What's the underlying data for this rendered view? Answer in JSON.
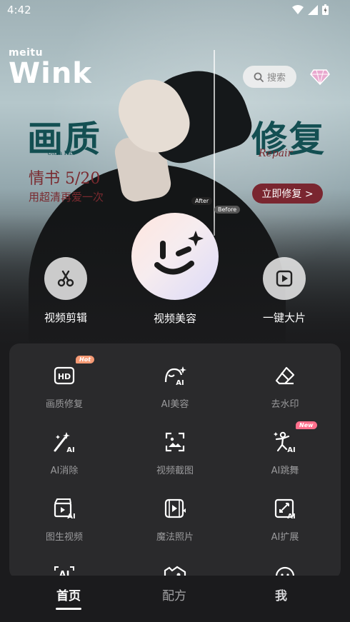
{
  "status_bar": {
    "time": "4:42"
  },
  "brand": {
    "top": "meitu",
    "name": "Wink"
  },
  "search": {
    "placeholder": "搜索"
  },
  "banner": {
    "title_left": "画质",
    "subtitle_left": "Ultra HD",
    "film_title": "情书 5/20",
    "film_tagline": "用超清再爱一次",
    "title_right": "修复",
    "subtitle_right": "Repair",
    "cta": "立即修复 >",
    "tag_after": "After",
    "tag_before": "Before"
  },
  "quick_actions": [
    {
      "label": "视频剪辑",
      "icon": "scissors-icon"
    },
    {
      "label": "视频美容",
      "icon": "wink-face-icon"
    },
    {
      "label": "一键大片",
      "icon": "play-icon"
    }
  ],
  "tools": [
    {
      "label": "画质修复",
      "icon": "hd-icon",
      "badge": "Hot"
    },
    {
      "label": "AI美容",
      "icon": "ai-face-icon"
    },
    {
      "label": "去水印",
      "icon": "eraser-icon"
    },
    {
      "label": "AI消除",
      "icon": "magic-wand-icon"
    },
    {
      "label": "视频截图",
      "icon": "screenshot-icon"
    },
    {
      "label": "AI跳舞",
      "icon": "dance-icon",
      "badge": "New"
    },
    {
      "label": "图生视频",
      "icon": "image-to-video-icon"
    },
    {
      "label": "魔法照片",
      "icon": "magic-photo-icon"
    },
    {
      "label": "AI扩展",
      "icon": "expand-icon"
    }
  ],
  "tabs": [
    {
      "label": "首页",
      "active": true
    },
    {
      "label": "配方"
    },
    {
      "label": "我"
    }
  ],
  "colors": {
    "accent": "#7a2630",
    "panel": "#2a2a2c",
    "background": "#1b1b1d"
  }
}
